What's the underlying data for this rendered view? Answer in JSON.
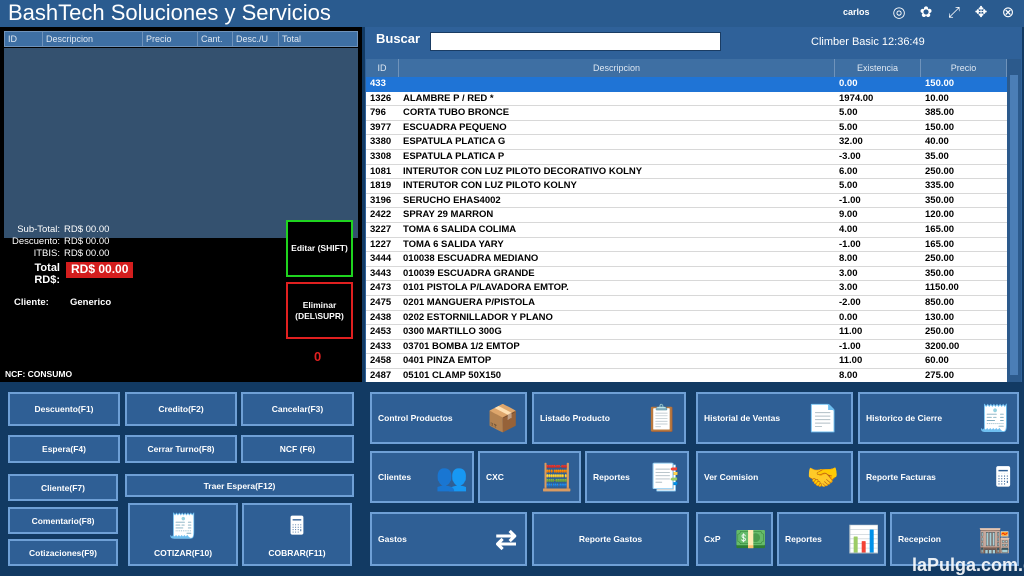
{
  "header": {
    "title": "BashTech Soluciones y Servicios",
    "user": "carlos"
  },
  "left_table": {
    "columns": [
      "ID",
      "Descripcion",
      "Precio",
      "Cant.",
      "Desc./U",
      "Total"
    ]
  },
  "totals": {
    "subtotal_label": "Sub-Total:",
    "subtotal": "RD$ 00.00",
    "descuento_label": "Descuento:",
    "descuento": "RD$ 00.00",
    "itbis_label": "ITBIS:",
    "itbis": "RD$ 00.00",
    "total_label": "Total RD$:",
    "total": "RD$ 00.00"
  },
  "cliente": {
    "label": "Cliente:",
    "value": "Generico"
  },
  "actions": {
    "editar": "Editar (SHIFT)",
    "eliminar": "Eliminar (DEL\\SUPR)",
    "counter": "0"
  },
  "ncf": "NCF: CONSUMO",
  "search": {
    "label": "Buscar",
    "value": "",
    "clock": "Climber Basic 12:36:49"
  },
  "products": {
    "columns": [
      "ID",
      "Descripcion",
      "Existencia",
      "Precio"
    ],
    "rows": [
      [
        "433",
        "",
        "0.00",
        "150.00"
      ],
      [
        "1326",
        "ALAMBRE  P / RED *",
        "1974.00",
        "10.00"
      ],
      [
        "796",
        "CORTA TUBO BRONCE",
        "5.00",
        "385.00"
      ],
      [
        "3977",
        "ESCUADRA PEQUENO",
        "5.00",
        "150.00"
      ],
      [
        "3380",
        "ESPATULA  PLATICA  G",
        "32.00",
        "40.00"
      ],
      [
        "3308",
        "ESPATULA  PLATICA P",
        "-3.00",
        "35.00"
      ],
      [
        "1081",
        "INTERUTOR CON LUZ PILOTO  DECORATIVO KOLNY",
        "6.00",
        "250.00"
      ],
      [
        "1819",
        "INTERUTOR CON LUZ PILOTO KOLNY",
        "5.00",
        "335.00"
      ],
      [
        "3196",
        "SERUCHO EHAS4002",
        "-1.00",
        "350.00"
      ],
      [
        "2422",
        "SPRAY 29 MARRON",
        "9.00",
        "120.00"
      ],
      [
        "3227",
        "TOMA 6  SALIDA  COLIMA",
        "4.00",
        "165.00"
      ],
      [
        "1227",
        "TOMA 6  SALIDA  YARY",
        "-1.00",
        "165.00"
      ],
      [
        "3444",
        "010038 ESCUADRA MEDIANO",
        "8.00",
        "250.00"
      ],
      [
        "3443",
        "010039 ESCUADRA GRANDE",
        "3.00",
        "350.00"
      ],
      [
        "2473",
        "0101 PISTOLA P/LAVADORA EMTOP.",
        "3.00",
        "1150.00"
      ],
      [
        "2475",
        "0201 MANGUERA P/PISTOLA",
        "-2.00",
        "850.00"
      ],
      [
        "2438",
        "0202 ESTORNILLADOR Y PLANO",
        "0.00",
        "130.00"
      ],
      [
        "2453",
        "0300 MARTILLO 300G",
        "11.00",
        "250.00"
      ],
      [
        "2433",
        "03701 BOMBA 1/2 EMTOP",
        "-1.00",
        "3200.00"
      ],
      [
        "2458",
        "0401 PINZA EMTOP",
        "11.00",
        "60.00"
      ],
      [
        "2487",
        "05101 CLAMP 50X150",
        "8.00",
        "275.00"
      ]
    ]
  },
  "left_buttons": {
    "descuento": "Descuento(F1)",
    "credito": "Credito(F2)",
    "cancelar": "Cancelar(F3)",
    "espera": "Espera(F4)",
    "cerrar_turno": "Cerrar Turno(F8)",
    "ncf": "NCF (F6)",
    "cliente": "Cliente(F7)",
    "traer_espera": "Traer Espera(F12)",
    "comentario": "Comentario(F8)",
    "cotizaciones": "Cotizaciones(F9)",
    "cotizar": "COTIZAR(F10)",
    "cobrar": "COBRAR(F11)"
  },
  "right_buttons": {
    "control_productos": "Control Productos",
    "listado_producto": "Listado Producto",
    "historial_ventas": "Historial de Ventas",
    "historico_cierre": "Historico de Cierre",
    "clientes": "Clientes",
    "cxc": "CXC",
    "reportes": "Reportes",
    "ver_comision": "Ver Comision",
    "reporte_facturas": "Reporte Facturas",
    "gastos": "Gastos",
    "reporte_gastos": "Reporte Gastos",
    "cxp": "CxP",
    "reportes2": "Reportes",
    "recepcion": "Recepcion"
  },
  "watermark": "laPulga.com.do"
}
